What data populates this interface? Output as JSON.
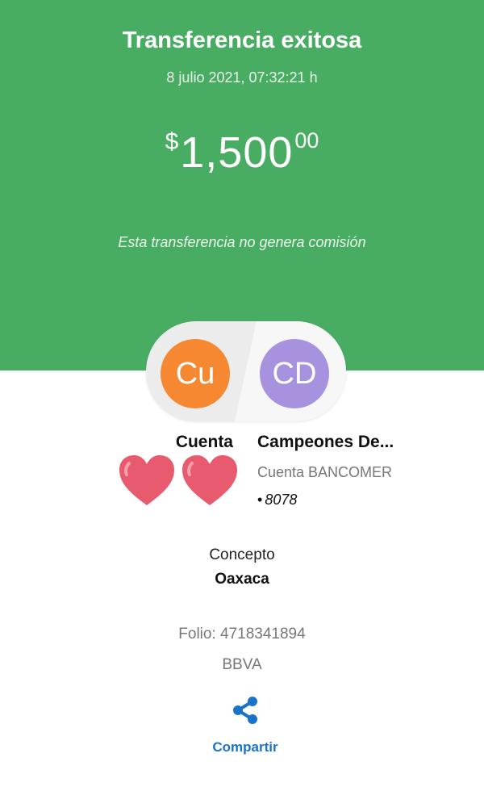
{
  "header": {
    "title": "Transferencia exitosa",
    "datetime": "8 julio 2021, 07:32:21 h",
    "amount": {
      "currency_symbol": "$",
      "main": "1,500",
      "cents": "00"
    },
    "commission_note": "Esta transferencia no genera comisión"
  },
  "avatars": {
    "from_initials": "Cu",
    "to_initials": "CD"
  },
  "from": {
    "name": "Cuenta"
  },
  "to": {
    "name": "Campeones De...",
    "bank_account": "Cuenta BANCOMER",
    "account_dot": "•",
    "account_number": "8078"
  },
  "concept": {
    "label": "Concepto",
    "value": "Oaxaca"
  },
  "folio": "Folio: 4718341894",
  "bank": "BBVA",
  "share": {
    "label": "Compartir",
    "icon": "share-icon"
  },
  "colors": {
    "header_green": "#48ad62",
    "avatar_from": "#f58830",
    "avatar_to": "#a792e0",
    "link_blue": "#1a73c9",
    "heart": "#e85a6e"
  }
}
